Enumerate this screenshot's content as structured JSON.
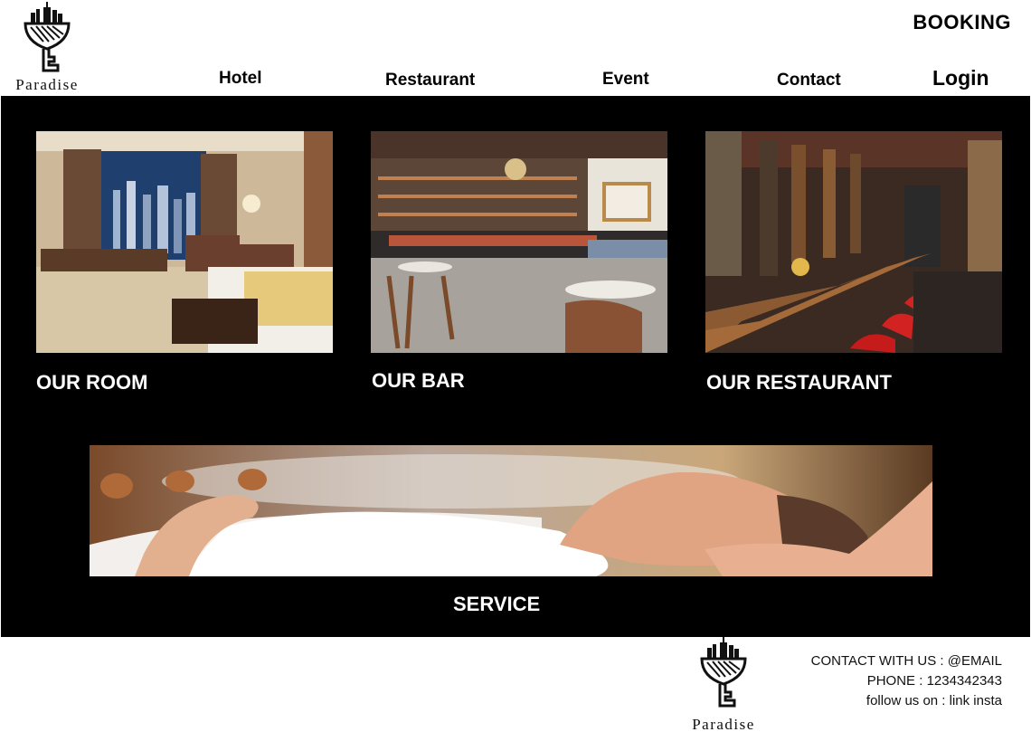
{
  "brand": {
    "name": "Paradise"
  },
  "nav": {
    "hotel": "Hotel",
    "restaurant": "Restaurant",
    "event": "Event",
    "contact": "Contact",
    "login": "Login",
    "booking": "BOOKING"
  },
  "cards": [
    {
      "label": "OUR ROOM"
    },
    {
      "label": "OUR BAR"
    },
    {
      "label": "OUR RESTAURANT"
    }
  ],
  "service": {
    "label": "SERVICE"
  },
  "footer": {
    "contact_line": "CONTACT WITH US : @EMAIL",
    "phone_line": "PHONE : 1234342343",
    "follow_line": "follow  us on : link insta"
  },
  "colors": {
    "panel": "#000000",
    "text_light": "#ffffff",
    "text_dark": "#000000"
  }
}
